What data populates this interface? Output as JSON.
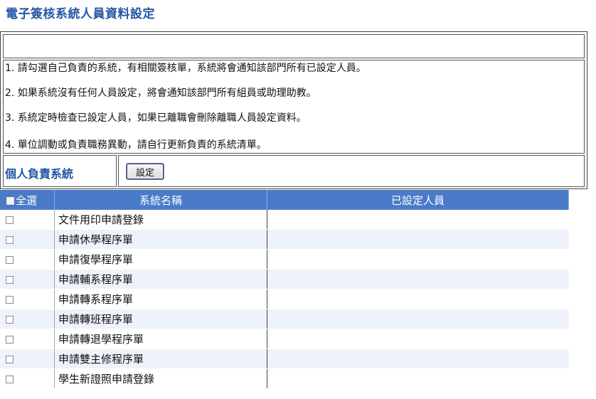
{
  "page": {
    "title": "電子簽核系統人員資料設定"
  },
  "notes": [
    "1. 請勾選自己負責的系統，有相關簽核單，系統將會通知該部門所有已設定人員。",
    "2. 如果系統沒有任何人員設定，將會通知該部門所有組員或助理助教。",
    "3. 系統定時檢查已設定人員，如果已離職會刪除離職人員設定資料。",
    "4. 單位調動或負責職務異動，請自行更新負責的系統清單。"
  ],
  "personal": {
    "label": "個人負責系統",
    "button_label": "設定"
  },
  "table": {
    "headers": {
      "select_all": "全選",
      "system_name": "系統名稱",
      "assigned_staff": "已設定人員"
    },
    "rows": [
      {
        "name": "文件用印申請登錄",
        "staff": ""
      },
      {
        "name": "申請休學程序單",
        "staff": ""
      },
      {
        "name": "申請復學程序單",
        "staff": ""
      },
      {
        "name": "申請輔系程序單",
        "staff": ""
      },
      {
        "name": "申請轉系程序單",
        "staff": ""
      },
      {
        "name": "申請轉班程序單",
        "staff": ""
      },
      {
        "name": "申請轉退學程序單",
        "staff": ""
      },
      {
        "name": "申請雙主修程序單",
        "staff": ""
      },
      {
        "name": "學生新證照申請登錄",
        "staff": ""
      }
    ]
  }
}
